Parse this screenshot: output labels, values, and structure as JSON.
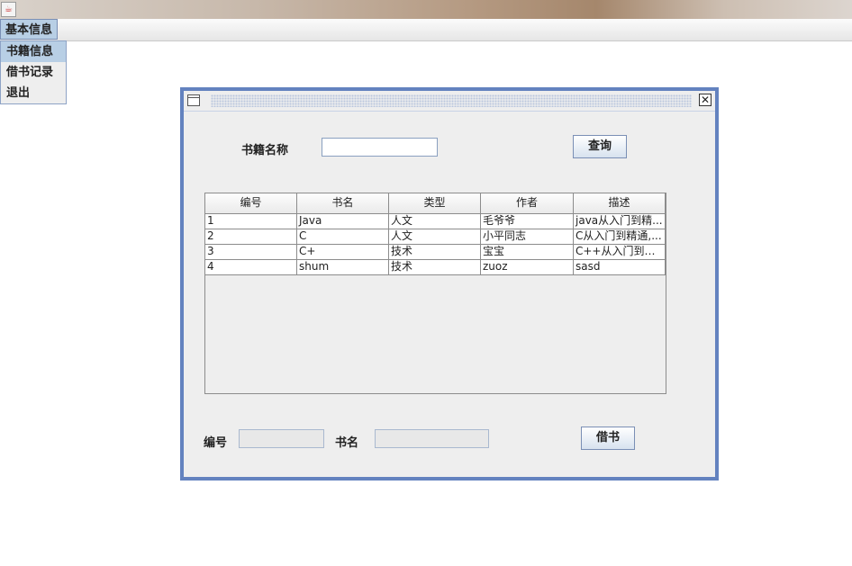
{
  "menu": {
    "title": "基本信息",
    "items": [
      {
        "label": "书籍信息"
      },
      {
        "label": "借书记录"
      },
      {
        "label": "退出"
      }
    ]
  },
  "window": {
    "close_glyph": "✕"
  },
  "search": {
    "label": "书籍名称",
    "value": "",
    "button": "查询"
  },
  "table": {
    "columns": [
      "编号",
      "书名",
      "类型",
      "作者",
      "描述"
    ],
    "rows": [
      [
        "1",
        "Java",
        "人文",
        "毛爷爷",
        "java从入门到精..."
      ],
      [
        "2",
        "C",
        "人文",
        "小平同志",
        "C从入门到精通,..."
      ],
      [
        "3",
        "C+",
        "技术",
        "宝宝",
        "C++从入门到精..."
      ],
      [
        "4",
        "shum",
        "技术",
        "zuoz",
        "sasd"
      ]
    ]
  },
  "borrow": {
    "id_label": "编号",
    "id_value": "",
    "name_label": "书名",
    "name_value": "",
    "button": "借书"
  },
  "icons": {
    "app": "java-cup-icon",
    "frame": "window-icon",
    "close": "close-icon"
  }
}
